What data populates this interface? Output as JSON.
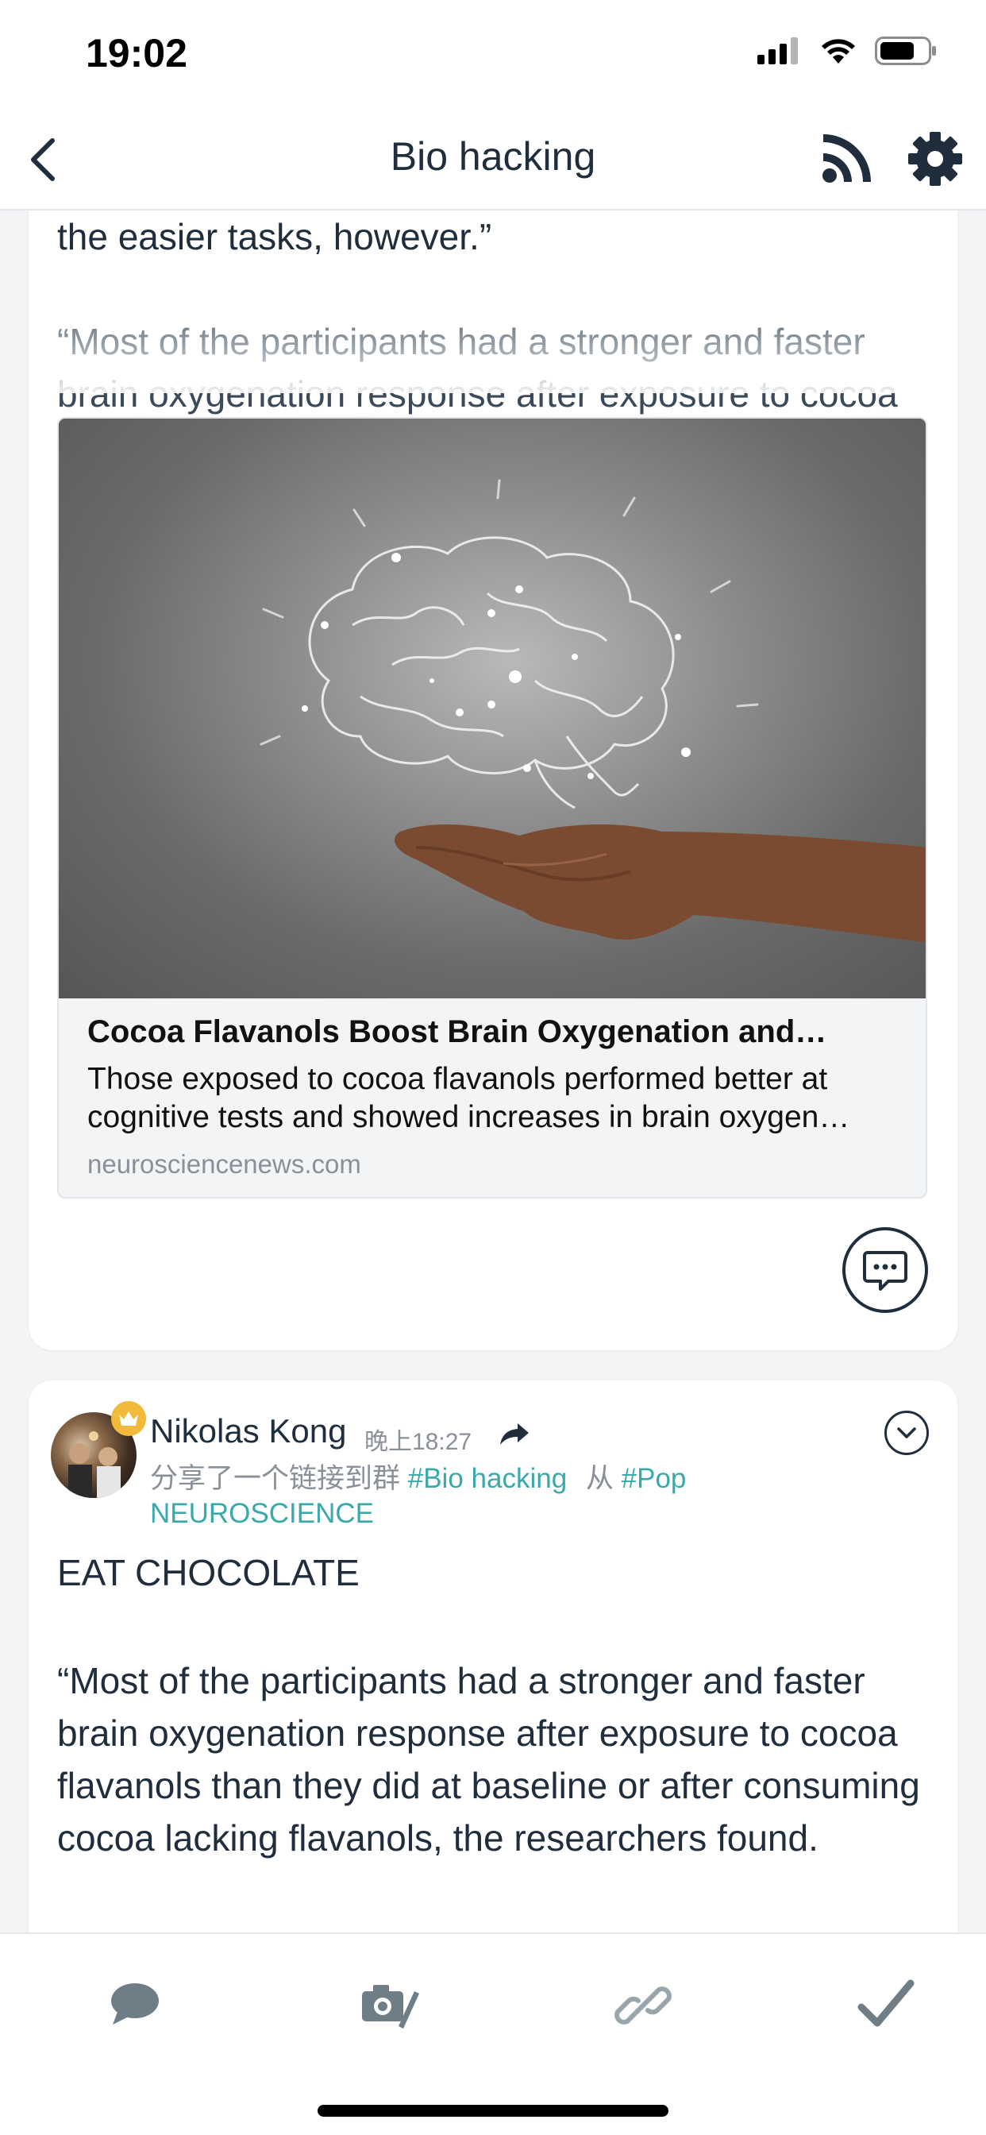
{
  "status_bar": {
    "time": "19:02"
  },
  "nav": {
    "title": "Bio hacking"
  },
  "post1": {
    "text_line": "the easier tasks, however.”",
    "quote_text": "“Most of the participants had a stronger and faster brain oxygenation response after exposure to cocoa",
    "link_preview": {
      "title": "Cocoa Flavanols Boost Brain Oxygenation and…",
      "description": "Those exposed to cocoa flavanols performed better at cognitive tests and showed increases in brain oxygen…",
      "domain": "neurosciencenews.com"
    }
  },
  "post2": {
    "author": "Nikolas Kong",
    "time": "晚上18:27",
    "share_prefix": "分享了一个链接到群",
    "group_tag": "#Bio hacking",
    "from_word": "从",
    "source_tag": "#Pop NEUROSCIENCE",
    "heading": "EAT CHOCOLATE",
    "body": "“Most of the participants had a stronger and faster brain oxygenation response after exposure to cocoa flavanols than they did at baseline or after consuming cocoa lacking flavanols, the researchers found."
  },
  "colors": {
    "accent": "#3aa9a9",
    "text": "#1f2d3d",
    "muted": "#8a9099",
    "icon_muted": "#6f7d87"
  },
  "icons": {
    "toolbar": [
      "comment-icon",
      "camera-icon",
      "link-icon",
      "check-icon"
    ],
    "nav": [
      "back-icon",
      "rss-icon",
      "gear-icon"
    ]
  }
}
